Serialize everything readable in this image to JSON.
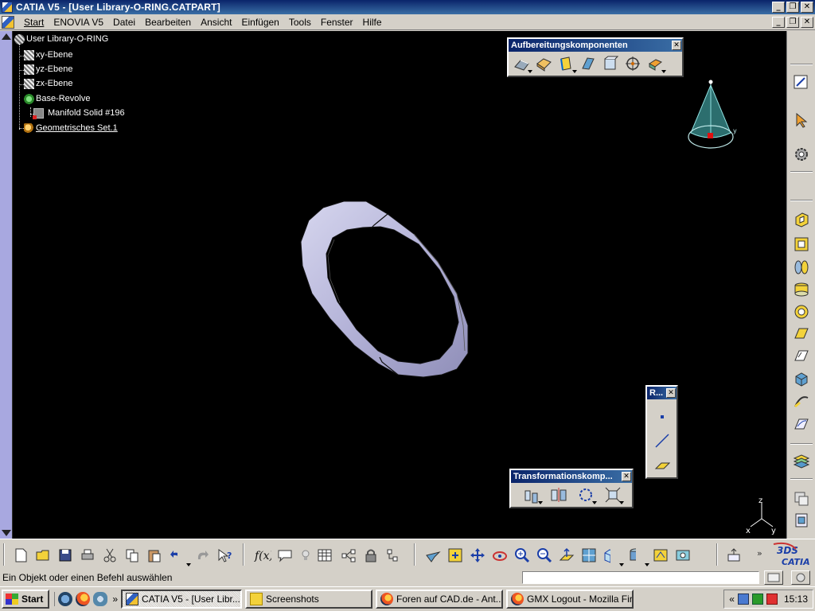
{
  "window": {
    "title": "CATIA V5 - [User Library-O-RING.CATPART]",
    "min": "_",
    "restore": "❐",
    "close": "✕"
  },
  "menu": {
    "items": [
      "Start",
      "ENOVIA V5",
      "Datei",
      "Bearbeiten",
      "Ansicht",
      "Einfügen",
      "Tools",
      "Fenster",
      "Hilfe"
    ]
  },
  "tree": {
    "root": "User Library-O-RING",
    "planes": [
      "xy-Ebene",
      "yz-Ebene",
      "zx-Ebene"
    ],
    "body": "Base-Revolve",
    "solid": "Manifold Solid #196",
    "geoset": "Geometrisches Set.1"
  },
  "toolbars": {
    "aufbereitung": {
      "title": "Aufbereitungskomponenten",
      "close": "✕"
    },
    "referenz": {
      "title": "R...",
      "close": "✕"
    },
    "transformation": {
      "title": "Transformationskomp...",
      "close": "✕"
    }
  },
  "axis": {
    "x": "x",
    "y": "y",
    "z": "z"
  },
  "status": {
    "text": "Ein Objekt oder einen Befehl auswählen",
    "command_value": ""
  },
  "taskbar": {
    "start": "Start",
    "overflow": "»",
    "tasks": [
      {
        "label": "CATIA V5 - [User Libr...",
        "icon": "catia-icon",
        "active": true
      },
      {
        "label": "Screenshots",
        "icon": "folder-icon",
        "active": false
      },
      {
        "label": "Foren auf CAD.de - Ant...",
        "icon": "firefox-icon",
        "active": false
      },
      {
        "label": "GMX Logout - Mozilla Fire...",
        "icon": "firefox-icon",
        "active": false
      }
    ],
    "tray_expand": "«",
    "clock": "15:13"
  },
  "brand": {
    "logo": "CATIA",
    "mark": "3DS"
  },
  "colors": {
    "viewport_bg": "#000000",
    "ring_fill": "#b9b8dc",
    "titlebar": "#0a246a",
    "chrome": "#d4d0c8"
  }
}
